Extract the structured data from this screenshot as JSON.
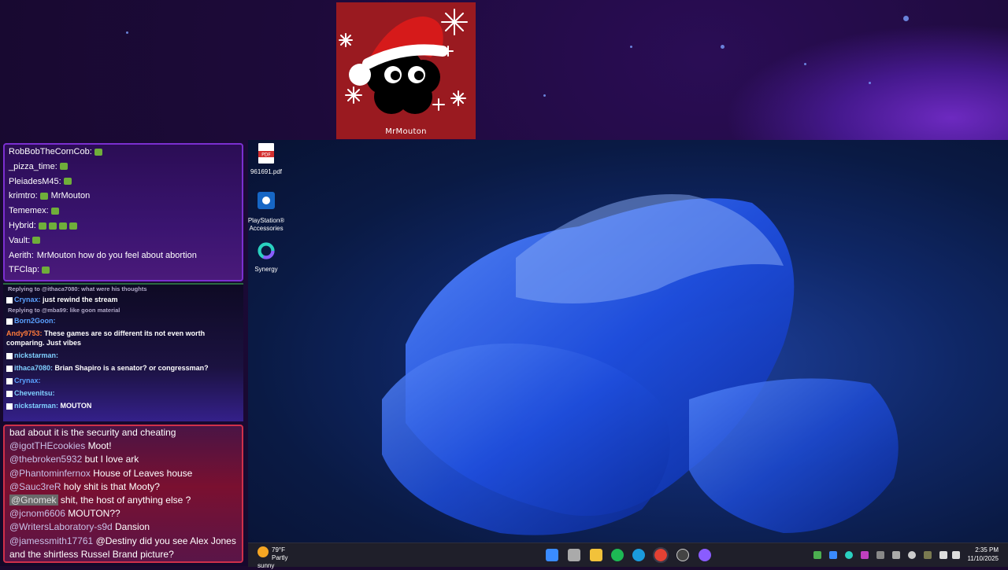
{
  "webcam": {
    "name": "MrMouton"
  },
  "chat1": [
    {
      "user": "RobBobTheCornCob:",
      "msg": "",
      "emotes": 1
    },
    {
      "user": "_pizza_time:",
      "msg": "",
      "emotes": 1
    },
    {
      "user": "PleiadesM45:",
      "msg": "",
      "emotes": 1
    },
    {
      "user": "krimtro:",
      "msg": "MrMouton",
      "emotes": 1
    },
    {
      "user": "Tememex:",
      "msg": "",
      "emotes": 1
    },
    {
      "user": "Hybrid:",
      "msg": "",
      "emotes": 4
    },
    {
      "user": "Vault:",
      "msg": "",
      "emotes": 1
    },
    {
      "user": "Aerith:",
      "msg": "MrMouton how do you feel about abortion",
      "emotes": 0
    },
    {
      "user": "TFClap:",
      "msg": "",
      "emotes": 1
    }
  ],
  "chat2": {
    "reply1": "Replying to @ithaca7080: what were his thoughts",
    "l1_user": "Crynax:",
    "l1_msg": "just rewind the stream",
    "reply2": "Replying to @mba99: like goon material",
    "l2_user": "Born2Goon:",
    "l3_user": "Andy9753:",
    "l3_msg": "These games are so different its not even worth comparing. Just vibes",
    "l4_user": "nickstarman:",
    "l5_user": "ithaca7080:",
    "l5_msg": "Brian Shapiro is a senator? or congressman?",
    "l6_user": "Crynax:",
    "l7_user": "Chevenitsu:",
    "l8_user": "nickstarman:",
    "l8_msg": "MOUTON"
  },
  "chat3": [
    {
      "mention": "",
      "msg": "bad about it is the security and cheating"
    },
    {
      "mention": "@igotTHEcookies",
      "msg": "Moot!"
    },
    {
      "mention": "@thebroken5932",
      "msg": "but I love ark"
    },
    {
      "mention": "@Phantominfernox",
      "msg": "House of Leaves house"
    },
    {
      "mention": "@Sauc3reR",
      "msg": "holy shit is that Mooty?"
    },
    {
      "mention": "@Gnomek",
      "msg": "shit, the host of anything else ?",
      "highlight": true
    },
    {
      "mention": "@jcnom6606",
      "msg": "MOUTON??"
    },
    {
      "mention": "@WritersLaboratory-s9d",
      "msg": "Dansion"
    },
    {
      "mention": "@jamessmith17761",
      "msg": "@Destiny did you see Alex Jones and the shirtless Russel Brand picture?"
    }
  ],
  "desktop_icons": [
    {
      "label": "961691.pdf",
      "icon": "pdf-file-icon"
    },
    {
      "label": "PlayStation® Accessories",
      "icon": "playstation-accessories-icon"
    },
    {
      "label": "Synergy",
      "icon": "synergy-icon"
    }
  ],
  "taskbar": {
    "weather_temp": "79°F",
    "weather_desc": "Partly sunny",
    "time": "2:35 PM",
    "date": "11/10/2025"
  },
  "colors": {
    "accent": "#7b2fd0",
    "desktop_blue": "#1d3f9a",
    "taskbar": "#1f1f2a"
  }
}
